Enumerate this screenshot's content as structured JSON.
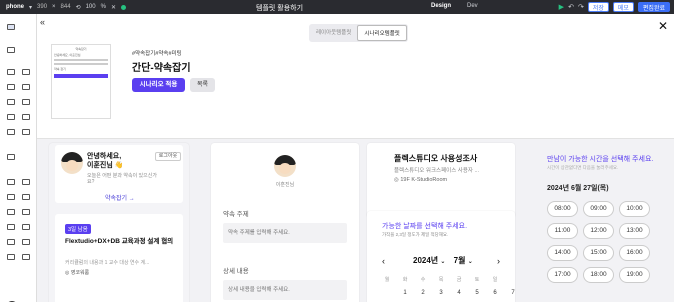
{
  "topbar": {
    "device": "phone",
    "width": "390",
    "times": "×",
    "height": "844",
    "zoom": "100",
    "percent": "%",
    "title": "템플릿 활용하기",
    "modes": [
      "Design",
      "Dev"
    ],
    "save_label": "저장",
    "memo_label": "메모",
    "edit_complete_label": "편집완료"
  },
  "tabs": [
    "레이아웃템플릿",
    "시나리오템플릿"
  ],
  "template": {
    "tags": "#약속잡기#약속#미팅",
    "title": "간단-약속잡기",
    "apply_label": "시나리오 적용",
    "list_label": "목록"
  },
  "thumb": {
    "header": "약속잡기",
    "greeting": "안녕하세요, 이훈진님",
    "button": "약속 잡기"
  },
  "card1": {
    "greeting_line1": "안녕하세요,",
    "greeting_line2": "이훈진님 👋",
    "login_label": "로그아웃",
    "subtitle": "오늘은 어떤 분과 약속이 있으신가요?",
    "link_label": "약속잡기 →",
    "badge": "3일 남음",
    "event_title": "Flextudio+DX+DB 교육과정 설계 협의",
    "event_desc": "커리큘럼의 내용과 1 교수 대상 연수 계...",
    "event_location": "◎ 영코워룸"
  },
  "card2": {
    "name": "이훈진님",
    "topic_label": "약속 주제",
    "topic_placeholder": "약속 주제를 입력해 주세요.",
    "detail_label": "상세 내용",
    "detail_placeholder": "상세 내용을 입력해 주세요."
  },
  "card3": {
    "title": "플렉스튜디오 사용성조사",
    "subtitle": "플렉스튜디오 워크스페이스 사용자 ...",
    "room": "◎ 19F K-StudioRoom"
  },
  "calendar": {
    "title": "가능한 날짜를 선택해 주세요.",
    "subtitle": "가작을 2,3일 정도가 제일 적당해요.",
    "year": "2024년",
    "month": "7월",
    "prev": "‹",
    "next": "›",
    "weekdays": [
      "월",
      "화",
      "수",
      "목",
      "금",
      "토",
      "일"
    ],
    "days": [
      "1",
      "2",
      "3",
      "4",
      "5",
      "6",
      "7"
    ]
  },
  "times": {
    "title": "만남이 가능한 시간을 선택해 주세요.",
    "subtitle": "시간이 상관없다면 다음을 눌러주세요.",
    "date": "2024년 6월 27일(목)",
    "slots": [
      "08:00",
      "09:00",
      "10:00",
      "11:00",
      "12:00",
      "13:00",
      "14:00",
      "15:00",
      "16:00",
      "17:00",
      "18:00",
      "19:00"
    ]
  },
  "colors": {
    "accent": "#5a3ff0",
    "topbar": "#2a2b30",
    "primary_blue": "#3b6ef5"
  }
}
